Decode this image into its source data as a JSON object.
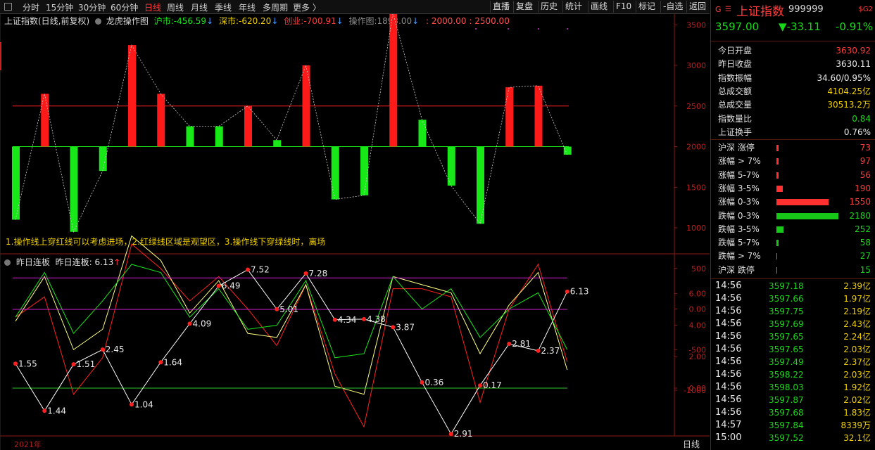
{
  "toolbar": {
    "tabs": [
      "分时",
      "15分钟",
      "30分钟",
      "60分钟",
      "日线",
      "周线",
      "月线",
      "季线",
      "年线",
      "多周期",
      "更多 〉"
    ],
    "active_tab": "日线",
    "right_buttons": [
      "直播",
      "复盘",
      "历史",
      "统计",
      "画线",
      "F10",
      "标记",
      "-自选",
      "返回"
    ]
  },
  "chart_header": {
    "title": "上证指数(日线,前复权)",
    "indicator": "龙虎操作图",
    "hushi_label": "沪市:",
    "hushi_value": "-456.59",
    "shenshi_label": "深市:",
    "shenshi_value": "-620.20",
    "chuangye_label": "创业:",
    "chuangye_value": "-700.91",
    "caozuo_label": "操作图:",
    "caozuo_value": "1893.00",
    "levels": ": 2000.00 : 2500.00"
  },
  "note": "1.操作线上穿红线可以考虑进场，2.红绿线区域是观望区，3.操作线下穿绿线时，离场",
  "lower_header": {
    "title": "昨日连板",
    "label": "昨日连板:",
    "value": "6.13"
  },
  "axis_upper": [
    "3500",
    "3000",
    "2500",
    "2000",
    "1500",
    "1000",
    "500",
    "0.00",
    "-500",
    "-1000"
  ],
  "axis_lower": [
    "6.00",
    "4.00",
    "2.00",
    "0.00"
  ],
  "footer": {
    "year": "2021年",
    "period": "日线"
  },
  "colors": {
    "up": "#ff1a1a",
    "down": "#18e818",
    "yellow_line": "#ffff80",
    "grid": "#8b1a1a"
  },
  "chart_data": [
    {
      "type": "bar",
      "title": "龙虎操作图",
      "baseline": 2000,
      "ylim": [
        -1000,
        3500
      ],
      "reference_lines": [
        2000,
        2500
      ],
      "values": [
        1100,
        2650,
        950,
        1700,
        3250,
        2650,
        2250,
        2250,
        2500,
        2080,
        3000,
        1350,
        1400,
        3650,
        2330,
        1520,
        1050,
        2730,
        2750,
        1900
      ],
      "dashed_line": [
        1100,
        2650,
        950,
        1700,
        3250,
        2650,
        2250,
        2250,
        2500,
        2080,
        3000,
        1350,
        1400,
        3650,
        2330,
        1520,
        1050,
        2730,
        2750,
        1900
      ]
    },
    {
      "type": "line",
      "ylim": [
        -1000,
        3500
      ],
      "series": [
        {
          "color": "#ff2020",
          "values": [
            -100,
            150,
            -1050,
            -600,
            800,
            500,
            100,
            400,
            0,
            -450,
            300,
            -800,
            -1450,
            250,
            250,
            150,
            -1150,
            0,
            550,
            -650
          ]
        },
        {
          "color": "#ffff80",
          "values": [
            -150,
            400,
            -500,
            -250,
            900,
            600,
            -50,
            350,
            -300,
            -350,
            300,
            -950,
            -1050,
            400,
            300,
            200,
            -550,
            50,
            450,
            -750
          ]
        },
        {
          "color": "#18e818",
          "values": [
            -100,
            450,
            -300,
            100,
            550,
            450,
            -100,
            250,
            -250,
            -200,
            350,
            -600,
            -550,
            400,
            0,
            250,
            -350,
            0,
            200,
            -500
          ]
        }
      ]
    },
    {
      "type": "line",
      "title": "昨日连板",
      "ylim": [
        -2.9,
        7.5
      ],
      "reference_lines": [
        0,
        5,
        7
      ],
      "values": [
        1.55,
        -1.44,
        1.51,
        2.45,
        -1.04,
        1.64,
        4.09,
        6.49,
        7.52,
        5.01,
        7.28,
        4.34,
        4.38,
        3.87,
        0.36,
        -2.91,
        0.17,
        2.81,
        2.37,
        6.13
      ],
      "labels": [
        "1.55",
        "1.44",
        "1.51",
        "2.45",
        "1.04",
        "1.64",
        "4.09",
        "6.49",
        "7.52",
        "5.01",
        "7.28",
        "4.34",
        "4.38",
        "3.87",
        "0.36",
        "2.91",
        "0.17",
        "2.81",
        "2.37",
        "6.13"
      ]
    }
  ],
  "quote": {
    "name": "上证指数",
    "code": "999999",
    "badge": "$G2",
    "price": "3597.00",
    "change": "▼-33.11",
    "pct": "-0.91%"
  },
  "stats": [
    {
      "label": "今日开盘",
      "value": "3630.92",
      "color": "red"
    },
    {
      "label": "昨日收盘",
      "value": "3630.11",
      "color": "white"
    },
    {
      "label": "指数振幅",
      "value": "34.60/0.95%",
      "color": "white"
    },
    {
      "label": "总成交额",
      "value": "4104.25亿",
      "color": "yellow"
    },
    {
      "label": "总成交量",
      "value": "30513.2万",
      "color": "yellow"
    },
    {
      "label": "指数量比",
      "value": "0.84",
      "color": "green"
    },
    {
      "label": "上证换手",
      "value": "0.76%",
      "color": "white"
    }
  ],
  "breadth": [
    {
      "label": "沪深 涨停",
      "value": "73",
      "count": 73,
      "kind": "up"
    },
    {
      "label": "涨幅 > 7%",
      "value": "97",
      "count": 97,
      "kind": "up"
    },
    {
      "label": "涨幅 5-7%",
      "value": "56",
      "count": 56,
      "kind": "up"
    },
    {
      "label": "涨幅 3-5%",
      "value": "190",
      "count": 190,
      "kind": "up"
    },
    {
      "label": "涨幅 0-3%",
      "value": "1550",
      "count": 1550,
      "kind": "up"
    },
    {
      "label": "跌幅 0-3%",
      "value": "2180",
      "count": 2180,
      "kind": "down"
    },
    {
      "label": "跌幅 3-5%",
      "value": "252",
      "count": 252,
      "kind": "down"
    },
    {
      "label": "跌幅 5-7%",
      "value": "58",
      "count": 58,
      "kind": "down"
    },
    {
      "label": "跌幅 > 7%",
      "value": "27",
      "count": 27,
      "kind": "down"
    },
    {
      "label": "沪深 跌停",
      "value": "15",
      "count": 15,
      "kind": "down"
    }
  ],
  "ticks": [
    {
      "time": "14:56",
      "price": "3597.18",
      "vol": "2.39亿"
    },
    {
      "time": "14:56",
      "price": "3597.66",
      "vol": "1.97亿"
    },
    {
      "time": "14:56",
      "price": "3597.75",
      "vol": "2.19亿"
    },
    {
      "time": "14:56",
      "price": "3597.69",
      "vol": "2.43亿"
    },
    {
      "time": "14:56",
      "price": "3597.65",
      "vol": "2.24亿"
    },
    {
      "time": "14:56",
      "price": "3597.65",
      "vol": "2.03亿"
    },
    {
      "time": "14:56",
      "price": "3597.49",
      "vol": "2.37亿"
    },
    {
      "time": "14:56",
      "price": "3598.22",
      "vol": "2.03亿"
    },
    {
      "time": "14:56",
      "price": "3598.03",
      "vol": "1.92亿"
    },
    {
      "time": "14:56",
      "price": "3597.87",
      "vol": "2.02亿"
    },
    {
      "time": "14:56",
      "price": "3597.68",
      "vol": "1.83亿"
    },
    {
      "time": "14:57",
      "price": "3597.84",
      "vol": "8339万"
    },
    {
      "time": "15:00",
      "price": "3597.52",
      "vol": "32.1亿"
    }
  ]
}
